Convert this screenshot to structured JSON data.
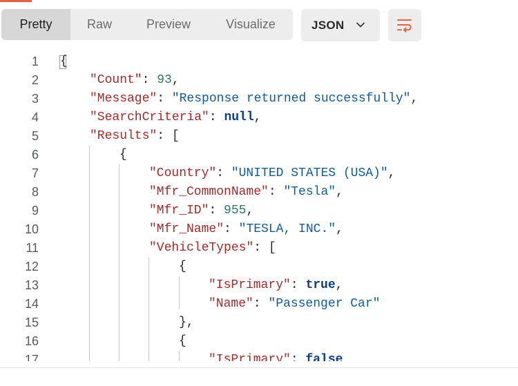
{
  "tabs": [
    "Pretty",
    "Raw",
    "Preview",
    "Visualize"
  ],
  "format": "JSON",
  "icons": {
    "format_chevron": "chevron-down-icon",
    "wrap": "word-wrap-icon"
  },
  "colors": {
    "accent": "#e8603c",
    "key": "#a52a2a",
    "string": "#0f5b9c",
    "number": "#277a5a",
    "keyword": "#0a3d8a"
  },
  "lines": [
    {
      "num": "1",
      "indent": 0,
      "tokens": [
        [
          "p",
          "{"
        ]
      ]
    },
    {
      "num": "2",
      "indent": 1,
      "tokens": [
        [
          "k",
          "\"Count\""
        ],
        [
          "p",
          ": "
        ],
        [
          "n",
          "93"
        ],
        [
          "p",
          ","
        ]
      ]
    },
    {
      "num": "3",
      "indent": 1,
      "tokens": [
        [
          "k",
          "\"Message\""
        ],
        [
          "p",
          ": "
        ],
        [
          "s",
          "\"Response returned successfully\""
        ],
        [
          "p",
          ","
        ]
      ]
    },
    {
      "num": "4",
      "indent": 1,
      "tokens": [
        [
          "k",
          "\"SearchCriteria\""
        ],
        [
          "p",
          ": "
        ],
        [
          "b",
          "null"
        ],
        [
          "p",
          ","
        ]
      ]
    },
    {
      "num": "5",
      "indent": 1,
      "tokens": [
        [
          "k",
          "\"Results\""
        ],
        [
          "p",
          ": ["
        ]
      ]
    },
    {
      "num": "6",
      "indent": 2,
      "tokens": [
        [
          "p",
          "{"
        ]
      ]
    },
    {
      "num": "7",
      "indent": 3,
      "tokens": [
        [
          "k",
          "\"Country\""
        ],
        [
          "p",
          ": "
        ],
        [
          "s",
          "\"UNITED STATES (USA)\""
        ],
        [
          "p",
          ","
        ]
      ]
    },
    {
      "num": "8",
      "indent": 3,
      "tokens": [
        [
          "k",
          "\"Mfr_CommonName\""
        ],
        [
          "p",
          ": "
        ],
        [
          "s",
          "\"Tesla\""
        ],
        [
          "p",
          ","
        ]
      ]
    },
    {
      "num": "9",
      "indent": 3,
      "tokens": [
        [
          "k",
          "\"Mfr_ID\""
        ],
        [
          "p",
          ": "
        ],
        [
          "n",
          "955"
        ],
        [
          "p",
          ","
        ]
      ]
    },
    {
      "num": "10",
      "indent": 3,
      "tokens": [
        [
          "k",
          "\"Mfr_Name\""
        ],
        [
          "p",
          ": "
        ],
        [
          "s",
          "\"TESLA, INC.\""
        ],
        [
          "p",
          ","
        ]
      ]
    },
    {
      "num": "11",
      "indent": 3,
      "tokens": [
        [
          "k",
          "\"VehicleTypes\""
        ],
        [
          "p",
          ": ["
        ]
      ]
    },
    {
      "num": "12",
      "indent": 4,
      "tokens": [
        [
          "p",
          "{"
        ]
      ]
    },
    {
      "num": "13",
      "indent": 5,
      "tokens": [
        [
          "k",
          "\"IsPrimary\""
        ],
        [
          "p",
          ": "
        ],
        [
          "b",
          "true"
        ],
        [
          "p",
          ","
        ]
      ]
    },
    {
      "num": "14",
      "indent": 5,
      "tokens": [
        [
          "k",
          "\"Name\""
        ],
        [
          "p",
          ": "
        ],
        [
          "s",
          "\"Passenger Car\""
        ]
      ]
    },
    {
      "num": "15",
      "indent": 4,
      "tokens": [
        [
          "p",
          "},"
        ]
      ]
    },
    {
      "num": "16",
      "indent": 4,
      "tokens": [
        [
          "p",
          "{"
        ]
      ]
    },
    {
      "num": "17",
      "indent": 5,
      "tokens": [
        [
          "k",
          "\"IsPrimary\""
        ],
        [
          "p",
          ": "
        ],
        [
          "b",
          "false"
        ]
      ]
    }
  ]
}
